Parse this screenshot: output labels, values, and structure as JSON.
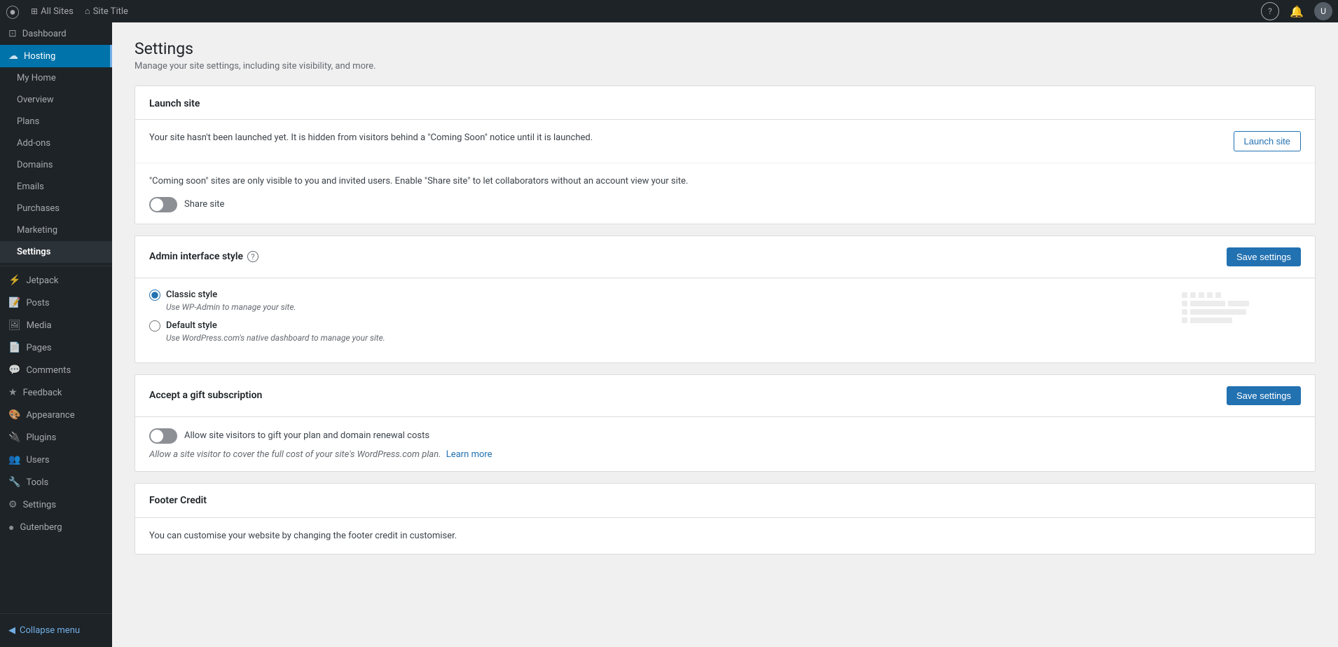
{
  "topbar": {
    "wp_icon": "⊕",
    "all_sites_label": "All Sites",
    "site_title_label": "Site Title",
    "help_icon": "?",
    "bell_icon": "🔔",
    "avatar_text": "U"
  },
  "sidebar": {
    "dashboard_label": "Dashboard",
    "hosting_label": "Hosting",
    "my_home_label": "My Home",
    "overview_label": "Overview",
    "plans_label": "Plans",
    "addons_label": "Add-ons",
    "domains_label": "Domains",
    "emails_label": "Emails",
    "purchases_label": "Purchases",
    "marketing_label": "Marketing",
    "settings_label": "Settings",
    "jetpack_label": "Jetpack",
    "posts_label": "Posts",
    "media_label": "Media",
    "pages_label": "Pages",
    "comments_label": "Comments",
    "feedback_label": "Feedback",
    "appearance_label": "Appearance",
    "plugins_label": "Plugins",
    "users_label": "Users",
    "tools_label": "Tools",
    "settings2_label": "Settings",
    "gutenberg_label": "Gutenberg",
    "collapse_label": "Collapse menu"
  },
  "page": {
    "title": "Settings",
    "subtitle": "Manage your site settings, including site visibility, and more."
  },
  "launch_site_section": {
    "title": "Launch site",
    "body_text": "Your site hasn't been launched yet. It is hidden from visitors behind a \"Coming Soon\" notice until it is launched.",
    "button_label": "Launch site"
  },
  "share_site_section": {
    "body_text": "\"Coming soon\" sites are only visible to you and invited users. Enable \"Share site\" to let collaborators without an account view your site.",
    "toggle_label": "Share site",
    "toggle_state": "off"
  },
  "admin_interface_section": {
    "title": "Admin interface style",
    "save_button_label": "Save settings",
    "classic_style_label": "Classic style",
    "classic_style_desc": "Use WP-Admin to manage your site.",
    "default_style_label": "Default style",
    "default_style_desc": "Use WordPress.com's native dashboard to manage your site.",
    "selected": "classic"
  },
  "gift_subscription_section": {
    "title": "Accept a gift subscription",
    "save_button_label": "Save settings",
    "toggle_state": "off",
    "toggle_label": "Allow site visitors to gift your plan and domain renewal costs",
    "note_text": "Allow a site visitor to cover the full cost of your site's WordPress.com plan.",
    "learn_more_label": "Learn more"
  },
  "footer_credit_section": {
    "title": "Footer Credit",
    "body_text": "You can customise your website by changing the footer credit in customiser."
  }
}
